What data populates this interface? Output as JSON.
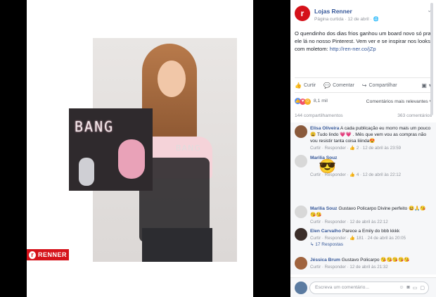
{
  "post": {
    "page_name": "Lojas Renner",
    "meta": "Página curtida · 12 de abril · ",
    "text": "O quendinho dos dias frios ganhou um board novo só pra ele lá no nosso Pinterest. Vem ver e se inspirar nos looks com moletom: ",
    "link": "http://ren-ner.co/jZp",
    "actions": {
      "like": "Curtir",
      "comment": "Comentar",
      "share": "Compartilhar"
    },
    "reaction_count": "8,1 mil",
    "sort_label": "Comentários mais relevantes ▾",
    "shares": "144 compartilhamentos",
    "comments_count": "363 comentários"
  },
  "photo": {
    "patch_text": "BANG",
    "shirt_text": "BANG",
    "logo_text": "RENNER",
    "logo_badge": "r"
  },
  "comments": [
    {
      "name": "Elisa Oliveira",
      "text": " A cada publicação eu morro mais um pouco 😩 Tudo lindo 💗💗 . Mês que vem vou as compras não vou resistir tanta coisa liiinda😍",
      "meta": "Curtir · Responder · 👍 2 · 12 de abril às 23:59",
      "avatar_color": "#8a5a3c"
    },
    {
      "name": "Marilia Souz",
      "text": "",
      "meta": "Curtir · Responder · 👍 4 · 12 de abril às 22:12",
      "avatar_color": "#d8d8d8"
    },
    {
      "name": "Marilia Souz",
      "text": " Gustavo Policarpo Divine perfeito 😃🙏😘😘😘",
      "meta": "Curtir · Responder · 12 de abril às 22:12",
      "avatar_color": "#d8d8d8"
    },
    {
      "name": "Elen Carvalho",
      "text": " Parece a Emily do bbb kkkk",
      "meta": "Curtir · Responder · 👍 181 · 24 de abril às 20:05",
      "avatar_color": "#3b2e2a"
    },
    {
      "name": "Jéssica Brum",
      "text": " Gustavo Policarpo 😘😘😘😘😘",
      "meta": "Curtir · Responder · 12 de abril às 21:32",
      "avatar_color": "#a0643f"
    }
  ],
  "replies_label": "↳ 17 Respostas",
  "sticker": "😎",
  "composer": {
    "placeholder": "Escreva um comentário..."
  }
}
